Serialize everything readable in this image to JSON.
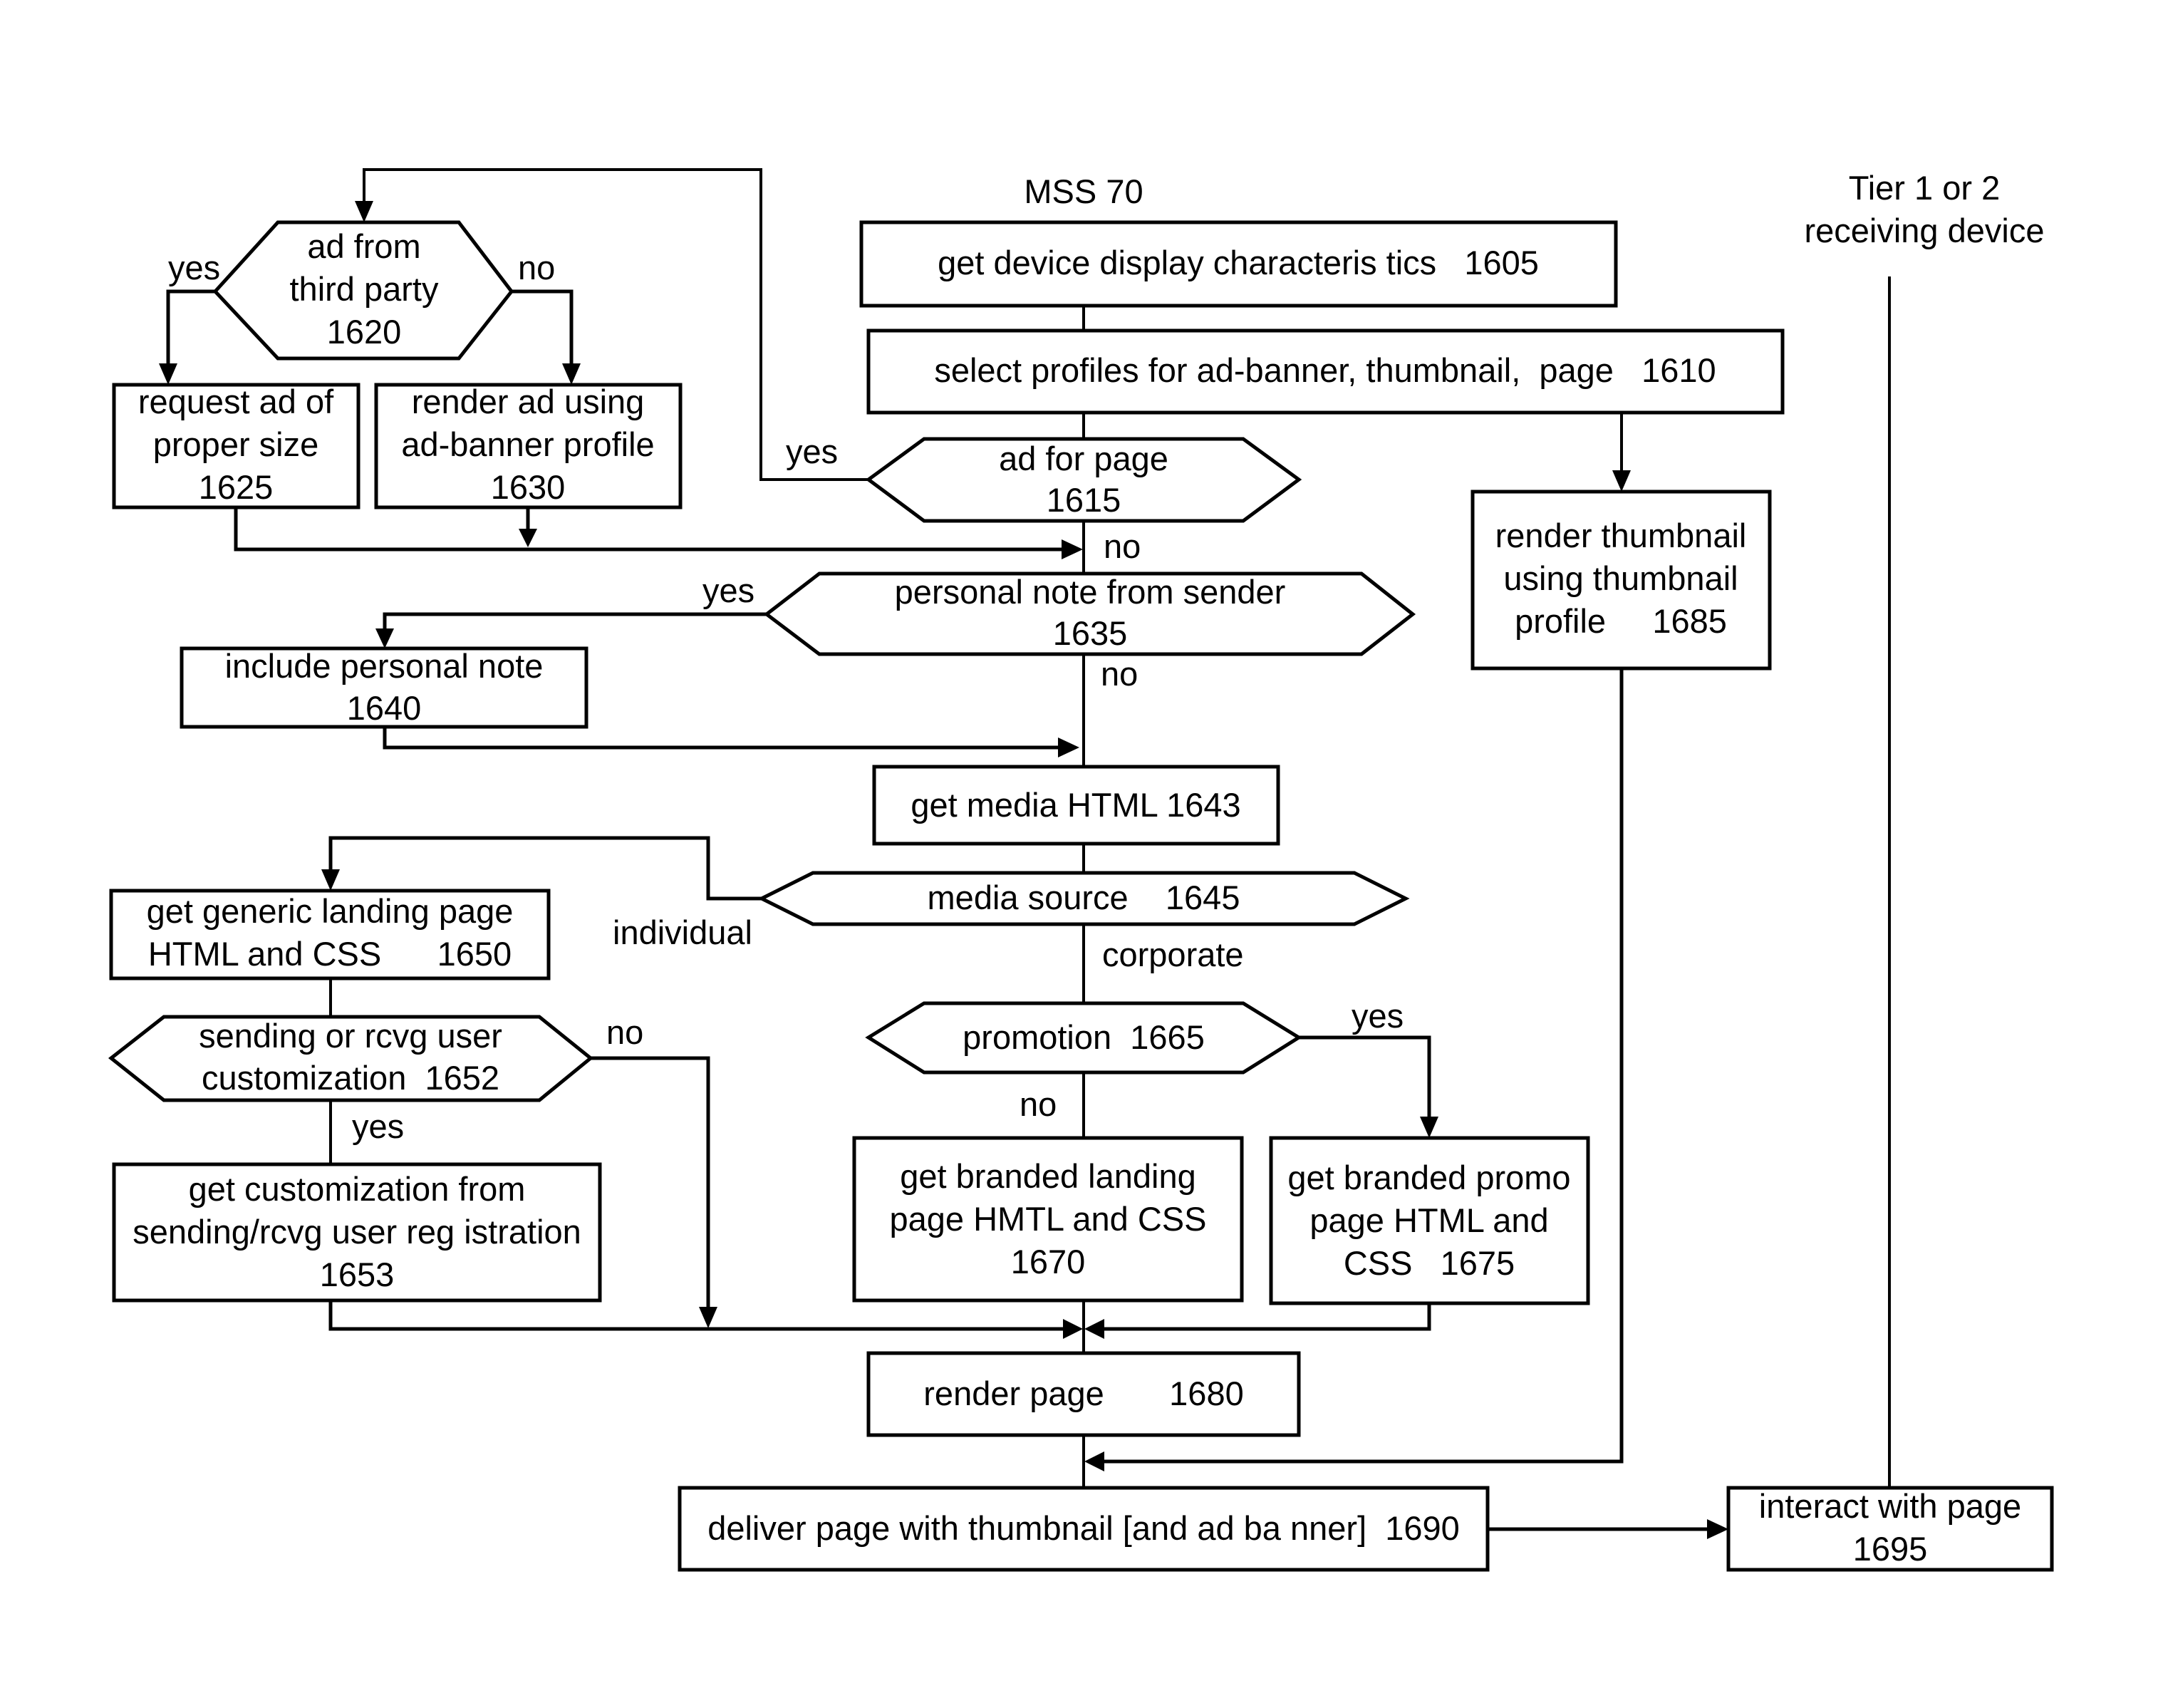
{
  "diagram": {
    "lanes": {
      "server": "MSS 70",
      "device": [
        "Tier 1 or 2",
        "receiving device"
      ]
    },
    "nodes": [
      {
        "id": "1605",
        "type": "process",
        "lines": [
          "get device display characteris tics   1605"
        ]
      },
      {
        "id": "1610",
        "type": "process",
        "lines": [
          "select profiles for ad-banner, thumbnail,  page   1610"
        ]
      },
      {
        "id": "1615",
        "type": "decision",
        "lines": [
          "ad for page",
          "1615"
        ]
      },
      {
        "id": "1620",
        "type": "decision",
        "lines": [
          "ad from",
          "third party",
          "1620"
        ]
      },
      {
        "id": "1625",
        "type": "process",
        "lines": [
          "request ad of",
          "proper size",
          "1625"
        ]
      },
      {
        "id": "1630",
        "type": "process",
        "lines": [
          "render ad using",
          "ad-banner profile",
          "1630"
        ]
      },
      {
        "id": "1635",
        "type": "decision",
        "lines": [
          "personal note from sender",
          "1635"
        ]
      },
      {
        "id": "1640",
        "type": "process",
        "lines": [
          "include personal note",
          "1640"
        ]
      },
      {
        "id": "1643",
        "type": "process",
        "lines": [
          "get media HTML 1643"
        ]
      },
      {
        "id": "1645",
        "type": "decision",
        "lines": [
          "media source    1645"
        ]
      },
      {
        "id": "1650",
        "type": "process",
        "lines": [
          "get generic landing page",
          "HTML and CSS      1650"
        ]
      },
      {
        "id": "1652",
        "type": "decision",
        "lines": [
          "sending or rcvg user",
          "customization  1652"
        ]
      },
      {
        "id": "1653",
        "type": "process",
        "lines": [
          "get customization from",
          "sending/rcvg user reg istration",
          "1653"
        ]
      },
      {
        "id": "1665",
        "type": "decision",
        "lines": [
          "promotion  1665"
        ]
      },
      {
        "id": "1670",
        "type": "process",
        "lines": [
          "get branded landing",
          "page HMTL and CSS",
          "1670"
        ]
      },
      {
        "id": "1675",
        "type": "process",
        "lines": [
          "get branded promo",
          "page HTML and",
          "CSS   1675"
        ]
      },
      {
        "id": "1680",
        "type": "process",
        "lines": [
          "render page       1680"
        ]
      },
      {
        "id": "1685",
        "type": "process",
        "lines": [
          "render thumbnail",
          "using thumbnail",
          "profile     1685"
        ]
      },
      {
        "id": "1690",
        "type": "process",
        "lines": [
          "deliver page with thumbnail [and ad ba nner]  1690"
        ]
      },
      {
        "id": "1695",
        "type": "process",
        "lines": [
          "interact with page",
          "1695"
        ]
      }
    ],
    "edge_labels": {
      "e1615_yes": "yes",
      "e1615_no": "no",
      "e1620_yes": "yes",
      "e1620_no": "no",
      "e1635_yes": "yes",
      "e1635_no": "no",
      "e1645_individual": "individual",
      "e1645_corporate": "corporate",
      "e1652_no": "no",
      "e1652_yes": "yes",
      "e1665_yes": "yes",
      "e1665_no": "no"
    }
  }
}
